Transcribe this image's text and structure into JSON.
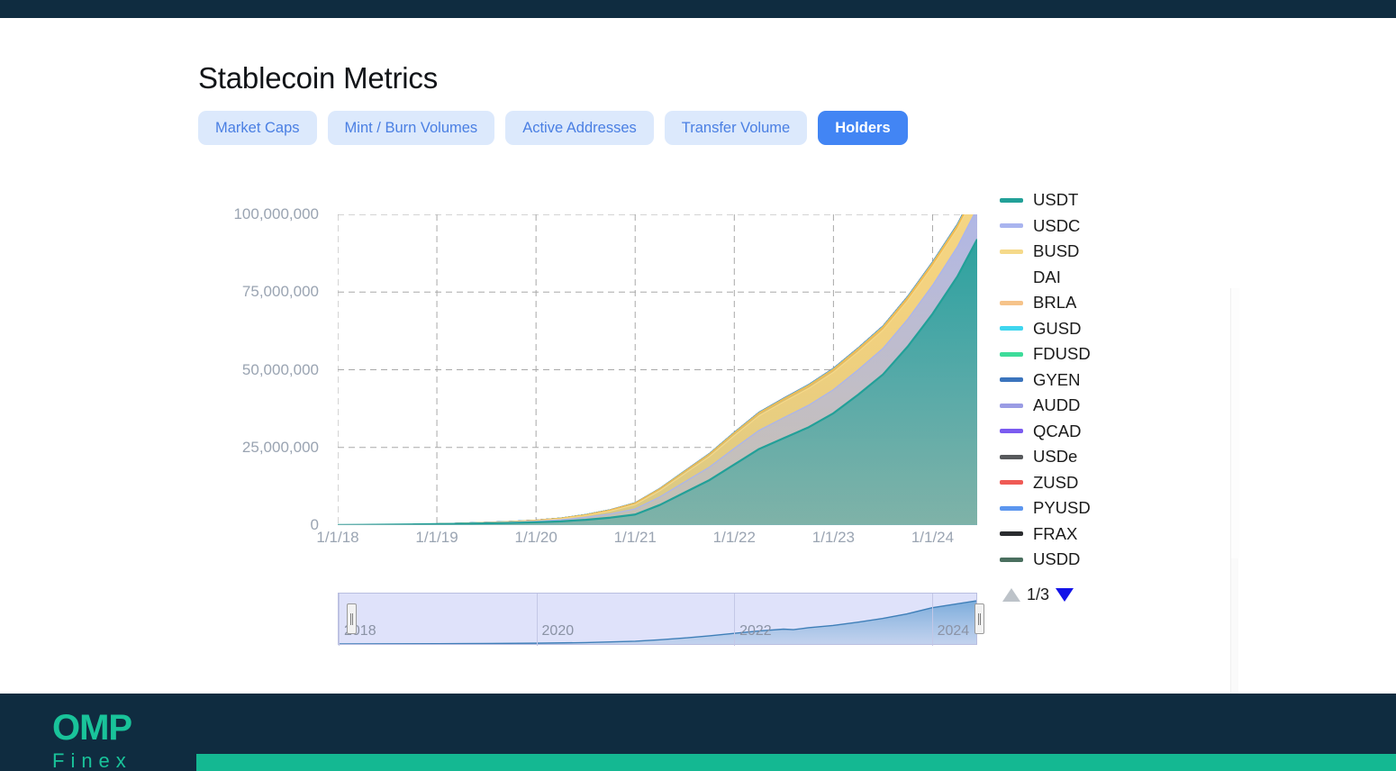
{
  "page": {
    "title": "Stablecoin Metrics",
    "accent_blue": "#4285f4",
    "tab_bg": "#dce9fc",
    "tab_text": "#4a7fe3",
    "topbar_color": "#0f2c40",
    "footer_color": "#0f2c40",
    "footer_bar_color": "#14b892"
  },
  "tabs": [
    {
      "label": "Market Caps",
      "active": false
    },
    {
      "label": "Mint / Burn Volumes",
      "active": false
    },
    {
      "label": "Active Addresses",
      "active": false
    },
    {
      "label": "Transfer Volume",
      "active": false
    },
    {
      "label": "Holders",
      "active": true
    }
  ],
  "legend": {
    "page_indicator": "1/3",
    "up_arrow": "triangle-up-icon",
    "down_arrow": "triangle-down-icon",
    "items": [
      {
        "label": "USDT",
        "color": "#22a098"
      },
      {
        "label": "USDC",
        "color": "#a9b4ef"
      },
      {
        "label": "BUSD",
        "color": "#f5d98a"
      },
      {
        "label": "DAI",
        "color": "#f5b councils"
      },
      {
        "label": "BRLA",
        "color": "#f6c38a"
      },
      {
        "label": "GUSD",
        "color": "#3fd6ef"
      },
      {
        "label": "FDUSD",
        "color": "#3ddc9a"
      },
      {
        "label": "GYEN",
        "color": "#3b74bd"
      },
      {
        "label": "AUDD",
        "color": "#9a9ce4"
      },
      {
        "label": "QCAD",
        "color": "#7b5bf0"
      },
      {
        "label": "USDe",
        "color": "#57595c"
      },
      {
        "label": "ZUSD",
        "color": "#ef5a55"
      },
      {
        "label": "PYUSD",
        "color": "#5c96ef"
      },
      {
        "label": "FRAX",
        "color": "#2a2c2f"
      },
      {
        "label": "USDD",
        "color": "#4a6f5f"
      }
    ]
  },
  "navigator": {
    "ticks": [
      "2018",
      "2020",
      "2022",
      "2024"
    ],
    "left_handle": "range-handle-left",
    "right_handle": "range-handle-right",
    "series_color": "#4d87c4",
    "fill_color": "#cfd6f7"
  },
  "footer": {
    "logo_main": "OMP",
    "logo_sub": "Finex"
  },
  "chart_data": {
    "type": "area",
    "stacked": true,
    "title": "Stablecoin Metrics — Holders",
    "xlabel": "",
    "ylabel": "",
    "grid": true,
    "legend_position": "right",
    "ylim": [
      0,
      100000000
    ],
    "yticks": [
      0,
      25000000,
      50000000,
      75000000,
      100000000
    ],
    "ytick_labels": [
      "0",
      "25,000,000",
      "50,000,000",
      "75,000,000",
      "100,000,000"
    ],
    "x": [
      "1/1/18",
      "1/1/19",
      "1/1/20",
      "1/1/21",
      "1/1/22",
      "1/1/23",
      "1/1/24"
    ],
    "x_numeric": [
      2018.0,
      2019.0,
      2020.0,
      2021.0,
      2022.0,
      2023.0,
      2024.0
    ],
    "xtick_labels": [
      "1/1/18",
      "1/1/19",
      "1/1/20",
      "1/1/21",
      "1/1/22",
      "1/1/23",
      "1/1/24"
    ],
    "x_samples": [
      2018.0,
      2018.25,
      2018.5,
      2018.75,
      2019.0,
      2019.25,
      2019.5,
      2019.75,
      2020.0,
      2020.25,
      2020.5,
      2020.75,
      2021.0,
      2021.25,
      2021.5,
      2021.75,
      2022.0,
      2022.25,
      2022.5,
      2022.75,
      2023.0,
      2023.25,
      2023.5,
      2023.75,
      2024.0,
      2024.25,
      2024.45
    ],
    "series": [
      {
        "name": "USDT",
        "color": "#22a098",
        "values": [
          50000,
          90000,
          150000,
          220000,
          320000,
          430000,
          560000,
          700000,
          900000,
          1200000,
          1700000,
          2400000,
          3400000,
          6500000,
          10500000,
          14500000,
          19500000,
          24500000,
          28000000,
          31500000,
          36000000,
          42000000,
          48500000,
          57500000,
          68000000,
          80000000,
          92000000
        ]
      },
      {
        "name": "USDC",
        "color": "#a9b4ef",
        "values": [
          0,
          5000,
          15000,
          30000,
          60000,
          100000,
          160000,
          230000,
          330000,
          500000,
          800000,
          1200000,
          1800000,
          2600000,
          3400000,
          4200000,
          5200000,
          6000000,
          6600000,
          7100000,
          7600000,
          8000000,
          8400000,
          8800000,
          9200000,
          9600000,
          10000000
        ]
      },
      {
        "name": "BUSD",
        "color": "#f5d98a",
        "values": [
          0,
          0,
          0,
          5000,
          15000,
          35000,
          70000,
          120000,
          200000,
          340000,
          560000,
          900000,
          1400000,
          2000000,
          2700000,
          3400000,
          4100000,
          4700000,
          5100000,
          5400000,
          5600000,
          5750000,
          5850000,
          5950000,
          6050000,
          5700000,
          5600000
        ]
      },
      {
        "name": "DAI",
        "color": "#f5b84a",
        "values": [
          0,
          2000,
          6000,
          12000,
          22000,
          38000,
          60000,
          88000,
          125000,
          180000,
          260000,
          360000,
          480000,
          600000,
          700000,
          780000,
          850000,
          900000,
          930000,
          950000,
          960000,
          970000,
          975000,
          980000,
          985000,
          990000,
          995000
        ]
      },
      {
        "name": "BRLA",
        "color": "#f6c38a",
        "values": [
          0,
          0,
          0,
          0,
          0,
          0,
          0,
          0,
          0,
          0,
          0,
          0,
          0,
          0,
          0,
          2000,
          6000,
          12000,
          20000,
          30000,
          42000,
          56000,
          72000,
          90000,
          110000,
          130000,
          150000
        ]
      },
      {
        "name": "GUSD",
        "color": "#3fd6ef",
        "values": [
          0,
          0,
          1000,
          3000,
          6000,
          10000,
          15000,
          21000,
          28000,
          36000,
          45000,
          55000,
          66000,
          78000,
          88000,
          96000,
          103000,
          108000,
          112000,
          115000,
          117000,
          119000,
          120000,
          121000,
          122000,
          123000,
          124000
        ]
      },
      {
        "name": "FDUSD",
        "color": "#3ddc9a",
        "values": [
          0,
          0,
          0,
          0,
          0,
          0,
          0,
          0,
          0,
          0,
          0,
          0,
          0,
          0,
          0,
          0,
          0,
          0,
          0,
          0,
          0,
          5000,
          18000,
          36000,
          58000,
          82000,
          105000
        ]
      },
      {
        "name": "GYEN",
        "color": "#3b74bd",
        "values": [
          0,
          0,
          0,
          0,
          0,
          0,
          0,
          0,
          0,
          1000,
          3000,
          7000,
          14000,
          24000,
          36000,
          48000,
          60000,
          70000,
          78000,
          84000,
          89000,
          93000,
          96000,
          99000,
          101000,
          103000,
          105000
        ]
      },
      {
        "name": "AUDD",
        "color": "#9a9ce4",
        "values": [
          0,
          0,
          0,
          0,
          0,
          0,
          0,
          0,
          0,
          0,
          0,
          0,
          0,
          0,
          0,
          0,
          500,
          1500,
          3000,
          5000,
          7500,
          10000,
          13000,
          16000,
          19000,
          22000,
          25000
        ]
      },
      {
        "name": "QCAD",
        "color": "#7b5bf0",
        "values": [
          0,
          0,
          0,
          0,
          0,
          500,
          1200,
          2000,
          3000,
          4200,
          5600,
          7200,
          9000,
          10500,
          11800,
          12800,
          13600,
          14200,
          14600,
          14900,
          15100,
          15300,
          15400,
          15500,
          15600,
          15700,
          15800
        ]
      },
      {
        "name": "USDe",
        "color": "#57595c",
        "values": [
          0,
          0,
          0,
          0,
          0,
          0,
          0,
          0,
          0,
          0,
          0,
          0,
          0,
          0,
          0,
          0,
          0,
          0,
          0,
          0,
          0,
          0,
          0,
          0,
          2000,
          20000,
          45000
        ]
      },
      {
        "name": "ZUSD",
        "color": "#ef5a55",
        "values": [
          0,
          0,
          0,
          0,
          0,
          0,
          100,
          300,
          600,
          1000,
          1500,
          2100,
          2800,
          3400,
          3900,
          4300,
          4600,
          4800,
          4950,
          5050,
          5120,
          5170,
          5200,
          5230,
          5250,
          5270,
          5290
        ]
      },
      {
        "name": "PYUSD",
        "color": "#5c96ef",
        "values": [
          0,
          0,
          0,
          0,
          0,
          0,
          0,
          0,
          0,
          0,
          0,
          0,
          0,
          0,
          0,
          0,
          0,
          0,
          0,
          0,
          0,
          0,
          1000,
          6000,
          14000,
          24000,
          34000
        ]
      },
      {
        "name": "FRAX",
        "color": "#2a2c2f",
        "values": [
          0,
          0,
          0,
          0,
          0,
          0,
          0,
          0,
          0,
          0,
          0,
          1000,
          3000,
          6000,
          9500,
          13000,
          16000,
          18500,
          20000,
          21000,
          21800,
          22400,
          22800,
          23100,
          23400,
          23600,
          23800
        ]
      },
      {
        "name": "USDD",
        "color": "#4a6f5f",
        "values": [
          0,
          0,
          0,
          0,
          0,
          0,
          0,
          0,
          0,
          0,
          0,
          0,
          0,
          0,
          0,
          0,
          1000,
          3000,
          5500,
          8000,
          10500,
          12500,
          14000,
          15200,
          16200,
          17000,
          17800
        ]
      }
    ]
  },
  "navigator_data": {
    "type": "area",
    "x": [
      2018.0,
      2018.5,
      2019.0,
      2019.5,
      2020.0,
      2020.5,
      2021.0,
      2021.25,
      2021.5,
      2021.75,
      2022.0,
      2022.25,
      2022.5,
      2022.6,
      2022.75,
      2023.0,
      2023.25,
      2023.5,
      2023.75,
      2024.0,
      2024.45
    ],
    "values": [
      200000,
      400000,
      700000,
      1100000,
      1700000,
      3000000,
      6000000,
      9000000,
      13000000,
      17500000,
      23000000,
      28000000,
      32000000,
      31000000,
      35000000,
      40000000,
      47000000,
      55000000,
      65000000,
      78000000,
      93000000
    ],
    "ymax": 100000000
  }
}
